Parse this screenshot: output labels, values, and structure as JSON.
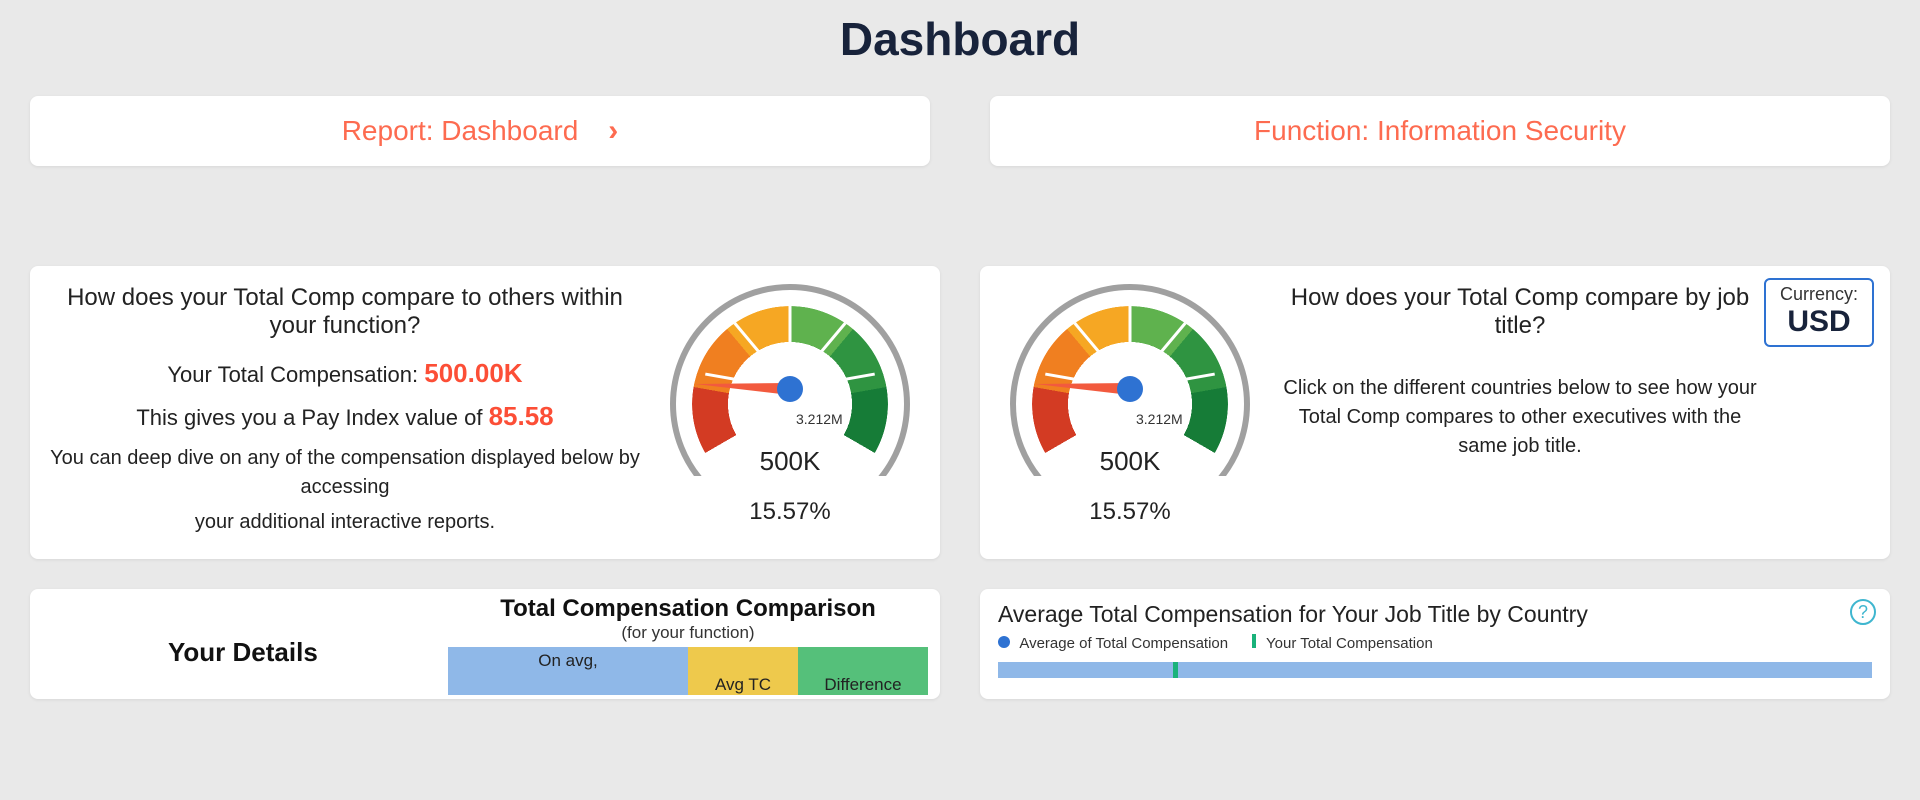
{
  "page_title": "Dashboard",
  "top": {
    "report_label": "Report: Dashboard",
    "function_label": "Function: Information Security"
  },
  "colors": {
    "accent": "#fc4e36",
    "blue": "#2e72d2",
    "teal": "#3fb6cf",
    "series_blue": "#8fb8e8",
    "series_green": "#19b27a"
  },
  "card_function": {
    "heading": "How does your Total Comp compare to others within your function?",
    "comp_label": "Your Total Compensation:",
    "comp_value": "500.00K",
    "payindex_label": "This gives you a Pay Index value of",
    "payindex_value": "85.58",
    "body1": "You can deep dive on any of the compensation displayed below by accessing",
    "body2": "your additional interactive reports."
  },
  "card_title": {
    "heading": "How does your Total Comp compare by job title?",
    "body": "Click on the different countries below to see how your Total Comp compares to other executives with the same job title."
  },
  "currency": {
    "label": "Currency:",
    "value": "USD"
  },
  "gauge": {
    "max_label": "3.212M",
    "center_value": "500K",
    "percent": "15.57%"
  },
  "row2_left": {
    "details_title": "Your Details",
    "tcc_title": "Total Compensation Comparison",
    "tcc_sub": "(for your function)",
    "col1": "On avg,",
    "col2": "Avg TC",
    "col3": "Difference"
  },
  "row2_right": {
    "title": "Average Total Compensation for Your Job Title by Country",
    "legend1": "Average of Total Compensation",
    "legend2": "Your Total Compensation"
  },
  "chart_data": [
    {
      "type": "bar",
      "title": "Total Compensation Comparison (for your function)",
      "categories": [
        "On avg,",
        "Avg TC",
        "Difference"
      ],
      "values": null
    },
    {
      "type": "bar",
      "title": "Average Total Compensation for Your Job Title by Country",
      "series": [
        {
          "name": "Average of Total Compensation",
          "values": null
        },
        {
          "name": "Your Total Compensation",
          "values": null
        }
      ],
      "categories": null
    }
  ]
}
